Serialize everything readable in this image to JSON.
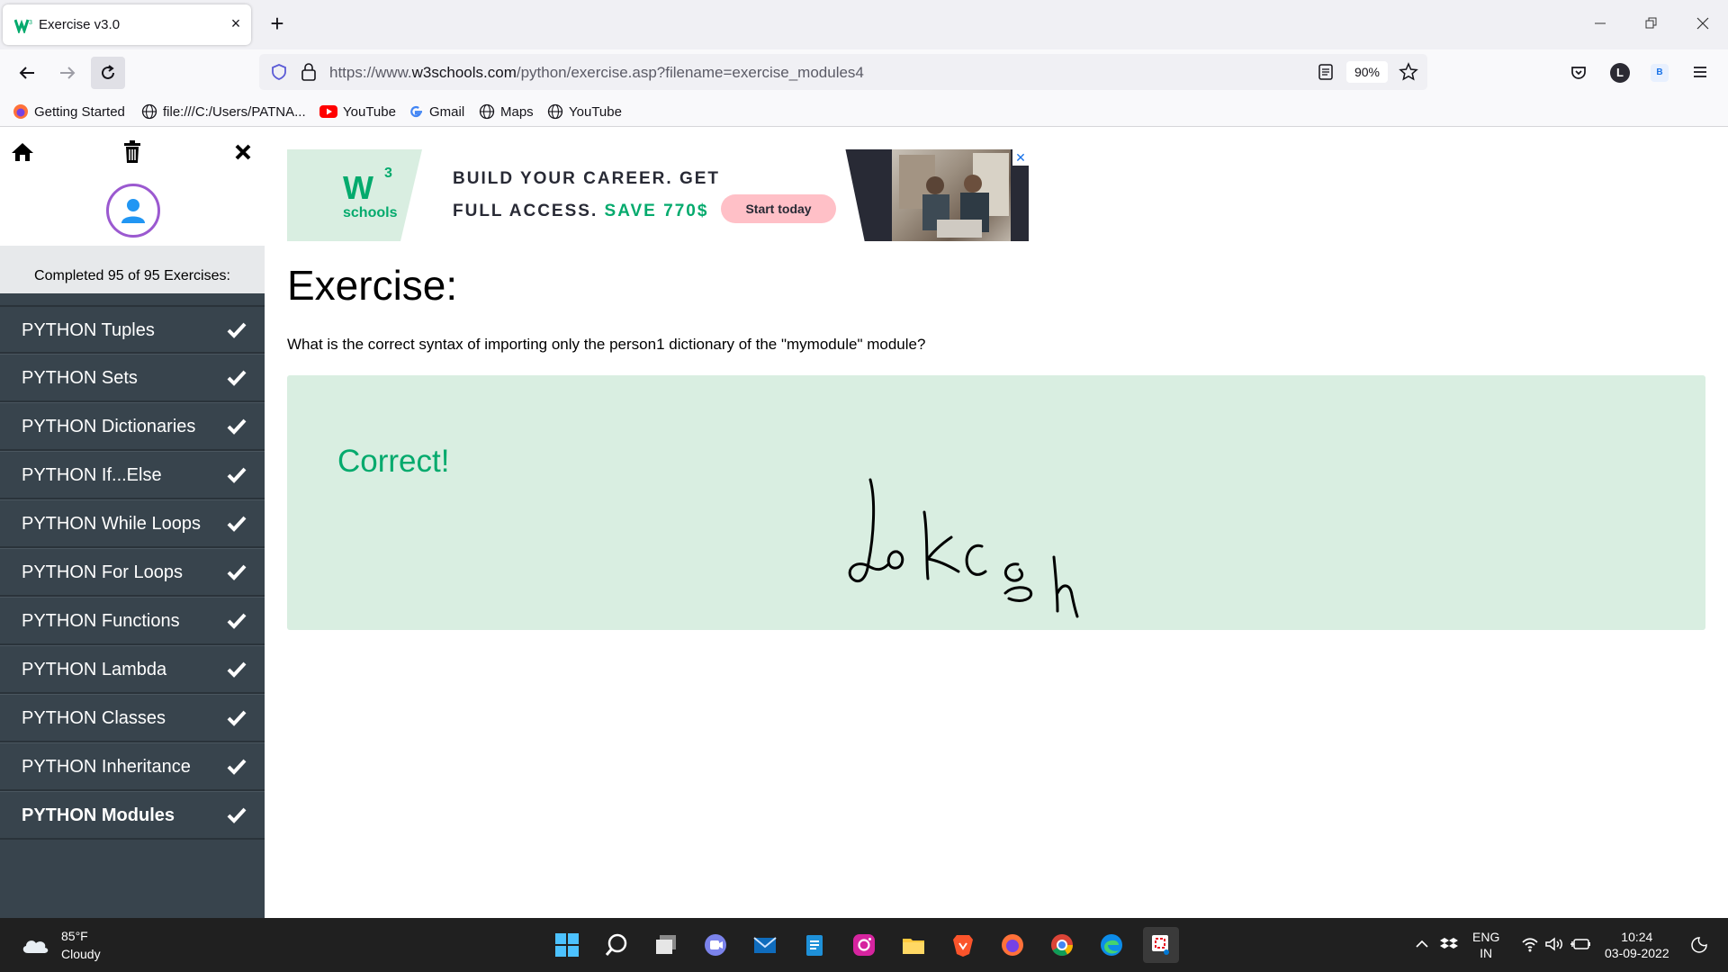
{
  "browser": {
    "tab_title": "Exercise v3.0",
    "tab_close": "×",
    "new_tab": "+",
    "url_prefix": "https://www.",
    "url_host": "w3schools.com",
    "url_path": "/python/exercise.asp?filename=exercise_modules4",
    "zoom": "90%",
    "profile_letter": "L",
    "ext_letter": "B",
    "bookmarks": [
      {
        "label": "Getting Started",
        "icon": "firefox-icon"
      },
      {
        "label": "file:///C:/Users/PATNA...",
        "icon": "globe-icon"
      },
      {
        "label": "YouTube",
        "icon": "youtube-icon"
      },
      {
        "label": "Gmail",
        "icon": "google-icon"
      },
      {
        "label": "Maps",
        "icon": "globe-icon"
      },
      {
        "label": "YouTube",
        "icon": "globe-icon"
      }
    ]
  },
  "sidebar": {
    "progress": "Completed 95 of 95 Exercises:",
    "items": [
      {
        "label": "PYTHON Tuples"
      },
      {
        "label": "PYTHON Sets"
      },
      {
        "label": "PYTHON Dictionaries"
      },
      {
        "label": "PYTHON If...Else"
      },
      {
        "label": "PYTHON While Loops"
      },
      {
        "label": "PYTHON For Loops"
      },
      {
        "label": "PYTHON Functions"
      },
      {
        "label": "PYTHON Lambda"
      },
      {
        "label": "PYTHON Classes"
      },
      {
        "label": "PYTHON Inheritance"
      },
      {
        "label": "PYTHON Modules"
      }
    ]
  },
  "ad": {
    "logo_w": "W",
    "logo_sup": "3",
    "logo_text": "schools",
    "line1": "BUILD YOUR CAREER. GET",
    "line2_prefix": "FULL ACCESS.",
    "line2_highlight": "SAVE 770$",
    "button": "Start today",
    "close": "✕"
  },
  "main": {
    "title": "Exercise:",
    "question": "What is the correct syntax of importing only the person1 dictionary of the \"mymodule\" module?",
    "result": "Correct!"
  },
  "taskbar": {
    "temperature": "85°F",
    "condition": "Cloudy",
    "lang1": "ENG",
    "lang2": "IN",
    "time": "10:24",
    "date": "03-09-2022"
  },
  "colors": {
    "accent_green": "#04aa6d",
    "sidebar_bg": "#38444d",
    "result_bg": "#d9eee1"
  }
}
